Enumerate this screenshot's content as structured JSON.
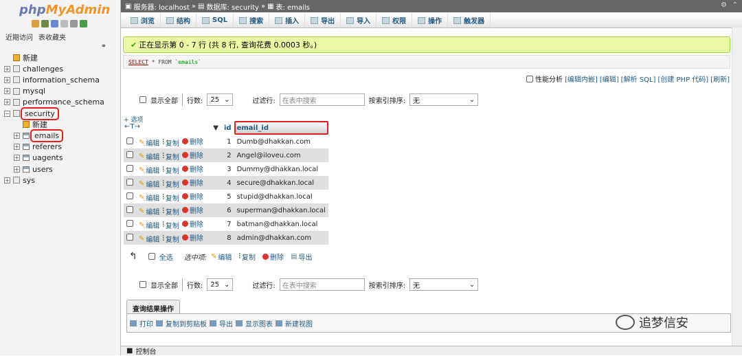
{
  "sidebar": {
    "logo_php": "php",
    "logo_my": "MyAdmin",
    "tabs": [
      "近期访问",
      "表收藏夹"
    ],
    "link_icon": "chain-link-icon",
    "tree": [
      {
        "label": "新建",
        "level": 0,
        "kind": "new"
      },
      {
        "label": "challenges",
        "level": 0,
        "kind": "db"
      },
      {
        "label": "information_schema",
        "level": 0,
        "kind": "db"
      },
      {
        "label": "mysql",
        "level": 0,
        "kind": "db"
      },
      {
        "label": "performance_schema",
        "level": 0,
        "kind": "db"
      },
      {
        "label": "security",
        "level": 0,
        "kind": "db",
        "highlight": true
      },
      {
        "label": "新建",
        "level": 1,
        "kind": "new"
      },
      {
        "label": "emails",
        "level": 1,
        "kind": "table",
        "highlight": true
      },
      {
        "label": "referers",
        "level": 1,
        "kind": "table"
      },
      {
        "label": "uagents",
        "level": 1,
        "kind": "table"
      },
      {
        "label": "users",
        "level": 1,
        "kind": "table"
      },
      {
        "label": "sys",
        "level": 0,
        "kind": "db"
      }
    ]
  },
  "topbar": {
    "server": "服务器: localhost",
    "sep1": "»",
    "database": "数据库: security",
    "sep2": "»",
    "table": "表: emails"
  },
  "menu": [
    "浏览",
    "结构",
    "SQL",
    "搜索",
    "插入",
    "导出",
    "导入",
    "权限",
    "操作",
    "触发器"
  ],
  "success_message": "正在显示第 0 - 7 行 (共 8 行, 查询花费 0.0003 秒。)",
  "sql": {
    "kw1": "SELECT",
    "rest": " * FROM ",
    "tbl": "`emails`"
  },
  "profiling": {
    "label": "性能分析",
    "links": [
      "[编辑内嵌]",
      "[编辑]",
      "[解析 SQL]",
      "[创建 PHP 代码]",
      "[刷新]"
    ]
  },
  "nav": {
    "show_all": "显示全部",
    "rows_label": "行数:",
    "rows_value": "25",
    "filter_label": "过滤行:",
    "filter_placeholder": "在表中搜索",
    "sort_label": "按索引排序:",
    "sort_value": "无"
  },
  "options_link": "+ 选项",
  "columns": [
    "id",
    "email_id"
  ],
  "row_actions": {
    "edit": "编辑",
    "copy": "复制",
    "delete": "删除"
  },
  "rows": [
    {
      "id": "1",
      "email": "Dumb@dhakkan.com"
    },
    {
      "id": "2",
      "email": "Angel@iloveu.com"
    },
    {
      "id": "3",
      "email": "Dummy@dhakkan.local"
    },
    {
      "id": "4",
      "email": "secure@dhakkan.local"
    },
    {
      "id": "5",
      "email": "stupid@dhakkan.local"
    },
    {
      "id": "6",
      "email": "superman@dhakkan.local"
    },
    {
      "id": "7",
      "email": "batman@dhakkan.local"
    },
    {
      "id": "8",
      "email": "admin@dhakkan.com"
    }
  ],
  "bulk": {
    "check_all": "全选",
    "with_selected": "选中项:",
    "edit": "编辑",
    "copy": "复制",
    "delete": "删除",
    "export": "导出"
  },
  "query_ops": {
    "title": "查询结果操作",
    "items": [
      "打印",
      "复制到剪贴板",
      "导出",
      "显示图表",
      "新建视图"
    ]
  },
  "console": "控制台",
  "watermark": "追梦信安"
}
